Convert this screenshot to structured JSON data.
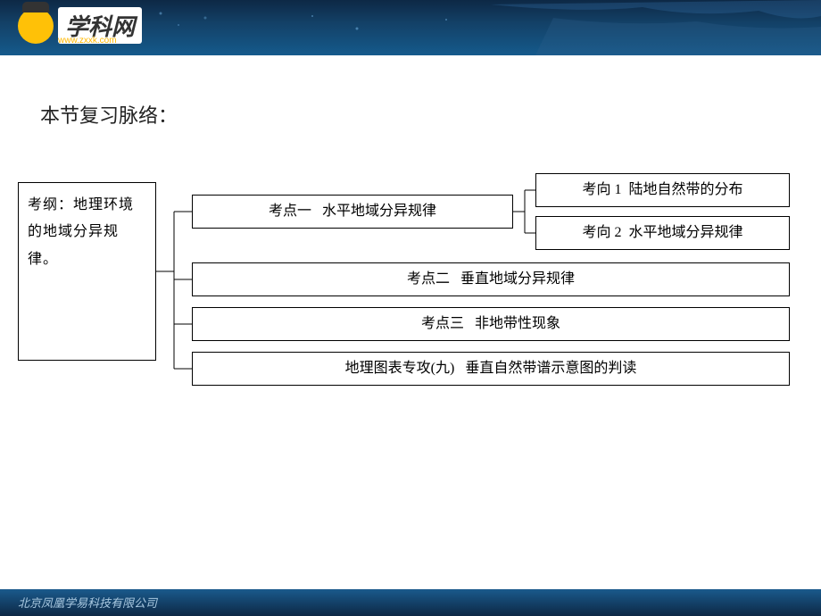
{
  "logo": {
    "text": "学科网",
    "url": "www.zxxk.com"
  },
  "title": "本节复习脉络：",
  "root": {
    "label": "考纲：",
    "content": "地理环境的地域分异规律。"
  },
  "topic1": {
    "label": "考点一",
    "content": "水平地域分异规律"
  },
  "sub1": {
    "label": "考向 1",
    "content": "陆地自然带的分布"
  },
  "sub2": {
    "label": "考向 2",
    "content": "水平地域分异规律"
  },
  "topic2": {
    "label": "考点二",
    "content": "垂直地域分异规律"
  },
  "topic3": {
    "label": "考点三",
    "content": "非地带性现象"
  },
  "topic4": {
    "label": "地理图表专攻(九)",
    "content": "垂直自然带谱示意图的判读"
  },
  "footer": "北京凤凰学易科技有限公司"
}
